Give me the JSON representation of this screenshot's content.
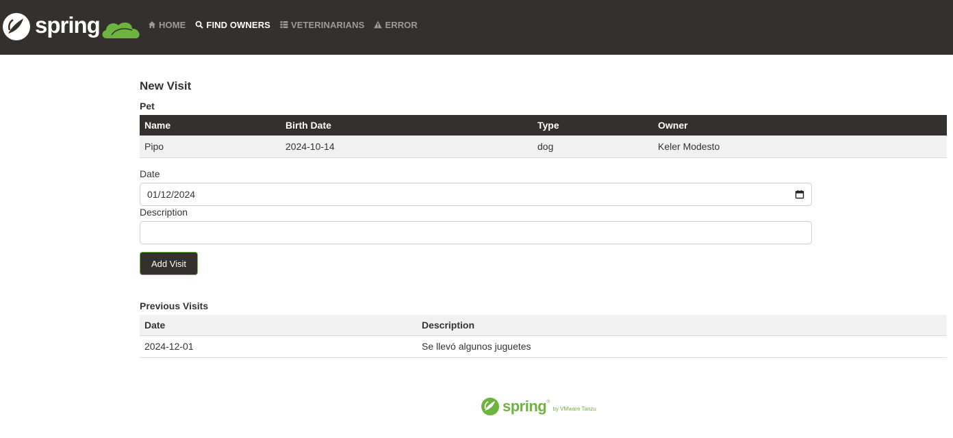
{
  "navbar": {
    "brand": "spring",
    "items": [
      {
        "label": "HOME",
        "icon": "home-icon",
        "active": false
      },
      {
        "label": "FIND OWNERS",
        "icon": "search-icon",
        "active": true
      },
      {
        "label": "VETERINARIANS",
        "icon": "list-icon",
        "active": false
      },
      {
        "label": "ERROR",
        "icon": "warning-icon",
        "active": false
      }
    ]
  },
  "page": {
    "title": "New Visit",
    "pet_section_label": "Pet",
    "pet_table": {
      "headers": [
        "Name",
        "Birth Date",
        "Type",
        "Owner"
      ],
      "row": [
        "Pipo",
        "2024-10-14",
        "dog",
        "Keler Modesto"
      ]
    },
    "form": {
      "date_label": "Date",
      "date_value": "01/12/2024",
      "description_label": "Description",
      "description_value": "",
      "submit_label": "Add Visit"
    },
    "previous_visits_label": "Previous Visits",
    "visits_table": {
      "headers": [
        "Date",
        "Description"
      ],
      "rows": [
        [
          "2024-12-01",
          "Se llevó algunos juguetes"
        ]
      ]
    }
  },
  "footer": {
    "brand": "spring",
    "trademark": "®",
    "byline": "by VMware Tanzu"
  },
  "colors": {
    "navbar_bg": "#34302d",
    "brand_green": "#6db33f",
    "nav_inactive": "#9b9b9b"
  }
}
